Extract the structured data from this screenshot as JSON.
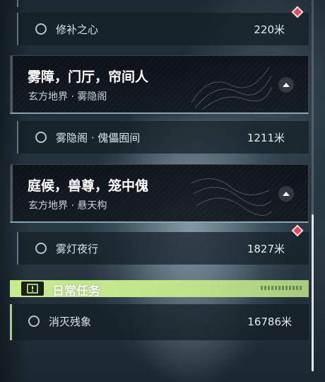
{
  "quests": [
    {
      "title": "雾障，门厅，帘间人",
      "location": "玄方地界 · 雾隐阁",
      "subtask": {
        "name": "雾隐阁 · 傀儡囿间",
        "distance": "1211米"
      }
    },
    {
      "title": "庭候，兽尊，笼中傀",
      "location": "玄方地界 · 悬天构",
      "subtask": {
        "name": "雾灯夜行",
        "distance": "1827米"
      }
    }
  ],
  "top_subtask": {
    "name": "修补之心",
    "distance": "220米"
  },
  "daily": {
    "header": "日常任务",
    "task": {
      "name": "消灭残象",
      "distance": "16786米"
    }
  },
  "scroll": {
    "position_fraction": 0.56,
    "visible_fraction": 0.42
  },
  "colors": {
    "daily_accent": "#c7ec8e",
    "marker_red": "#e04a5a",
    "card_underline": "#aad7eb"
  },
  "icons": [
    "circle-status-icon",
    "map-marker-diamond-icon",
    "track-arrow-icon",
    "exclamation-icon"
  ]
}
